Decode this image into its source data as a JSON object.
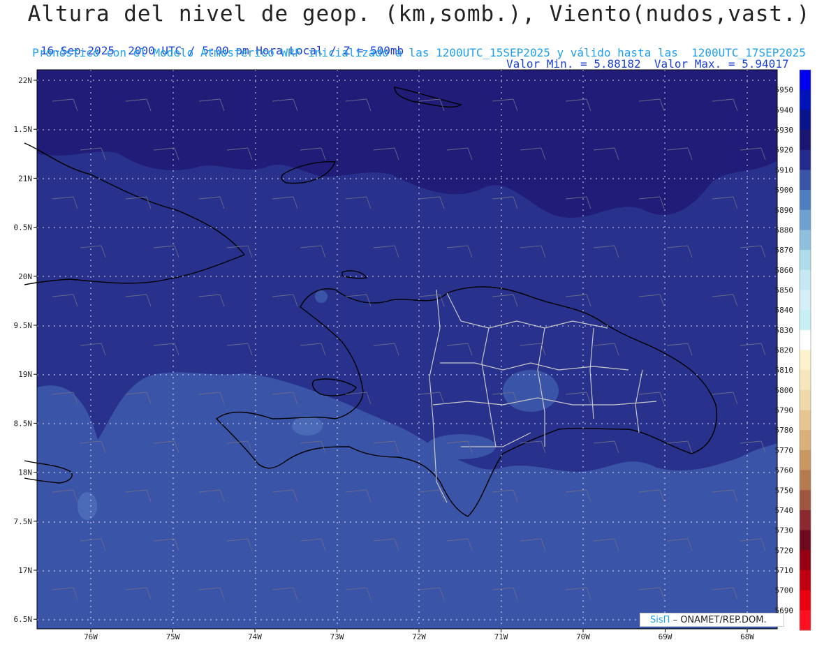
{
  "header": {
    "title": "Altura del nivel de geop. (km,somb.), Viento(nudos,vast.)",
    "time_line": "16-Sep-2025  2000 UTC / 5:00 pm Hora Local / Z = 500mb",
    "minmax_line": "Valor Min. = 5.88182  Valor Max. = 5.94017",
    "model_line": "Pronóstico con el Modelo Atmosferico WRF inicializado a las 1200UTC_15SEP2025 y válido hasta las  1200UTC_17SEP2025"
  },
  "map": {
    "lat_labels": [
      "22N",
      "1.5N",
      "21N",
      "0.5N",
      "20N",
      "9.5N",
      "19N",
      "8.5N",
      "18N",
      "7.5N",
      "17N",
      "6.5N"
    ],
    "lon_labels": [
      "76W",
      "75W",
      "74W",
      "73W",
      "72W",
      "71W",
      "70W",
      "69W",
      "68W"
    ],
    "colors": {
      "deep": "#201c78",
      "mid": "#28318c",
      "shallow": "#3a55a8",
      "patch": "#4a6ab8",
      "coast": "#000000",
      "border": "#c8c8c8",
      "grid": "#ffffff"
    }
  },
  "colorbar": {
    "levels": [
      "5950",
      "5940",
      "5930",
      "5920",
      "5910",
      "5900",
      "5890",
      "5880",
      "5870",
      "5860",
      "5850",
      "5840",
      "5830",
      "5820",
      "5810",
      "5800",
      "5790",
      "5780",
      "5770",
      "5760",
      "5750",
      "5740",
      "5730",
      "5720",
      "5710",
      "5700",
      "5690"
    ],
    "colors": [
      "#0000ee",
      "#0012b8",
      "#0a148a",
      "#1a1670",
      "#232a8c",
      "#3a55a8",
      "#4e7ec0",
      "#6ea0d0",
      "#8ec0de",
      "#aedceb",
      "#c6e8f2",
      "#d6eff6",
      "#c8f0f4",
      "#ffffff",
      "#fbf2cc",
      "#f6e6bc",
      "#efd9a8",
      "#e5c690",
      "#d8b078",
      "#c99760",
      "#b57a4e",
      "#a0553f",
      "#8a2a30",
      "#6e0a20",
      "#960012",
      "#c00010",
      "#e8000e",
      "#ff1020"
    ]
  },
  "credit": {
    "logo": "SisΠ",
    "text": "– ONAMET/REP.DOM."
  }
}
